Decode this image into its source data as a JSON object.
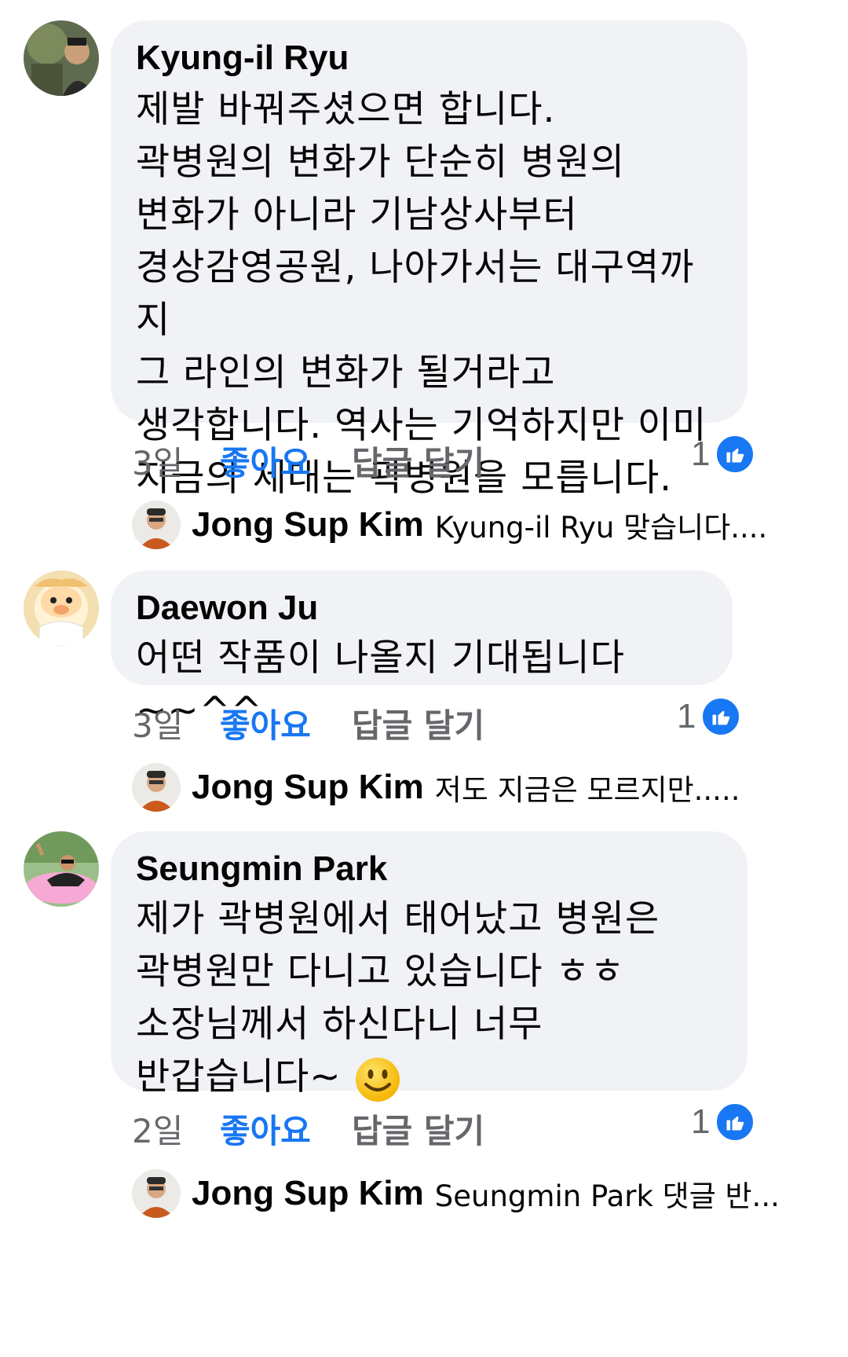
{
  "comments": [
    {
      "author": "Kyung-il Ryu",
      "text": "제발 바꿔주셨으면 합니다.\n곽병원의 변화가 단순히 병원의\n변화가 아니라 기남상사부터\n경상감영공원, 나아가서는 대구역까지\n그 라인의 변화가 될거라고\n생각합니다. 역사는 기억하지만 이미\n지금의 세대는 곽병원을 모릅니다.",
      "time": "3일",
      "like_label": "좋아요",
      "reply_label": "답글 달기",
      "reaction_count": "1",
      "reply": {
        "name": "Jong Sup Kim",
        "text": "Kyung-il Ryu 맞습니다...."
      }
    },
    {
      "author": "Daewon Ju",
      "text": "어떤 작품이 나올지 기대됩니다~~^^",
      "time": "3일",
      "like_label": "좋아요",
      "reply_label": "답글 달기",
      "reaction_count": "1",
      "reply": {
        "name": "Jong Sup Kim",
        "text": "저도 지금은 모르지만....."
      }
    },
    {
      "author": "Seungmin Park",
      "text": "제가 곽병원에서 태어났고 병원은\n곽병원만 다니고 있습니다 ㅎㅎ\n소장님께서 하신다니 너무\n반갑습니다~",
      "time": "2일",
      "like_label": "좋아요",
      "reply_label": "답글 달기",
      "reaction_count": "1",
      "reply": {
        "name": "Jong Sup Kim",
        "text": "Seungmin Park 댓글 반..."
      }
    }
  ],
  "colors": {
    "link": "#1877f2",
    "bubble": "#f0f2f5",
    "meta": "#65676b"
  },
  "icons": {
    "reaction": "thumbs-up-icon",
    "emoji": "smiley-emoji-icon"
  }
}
